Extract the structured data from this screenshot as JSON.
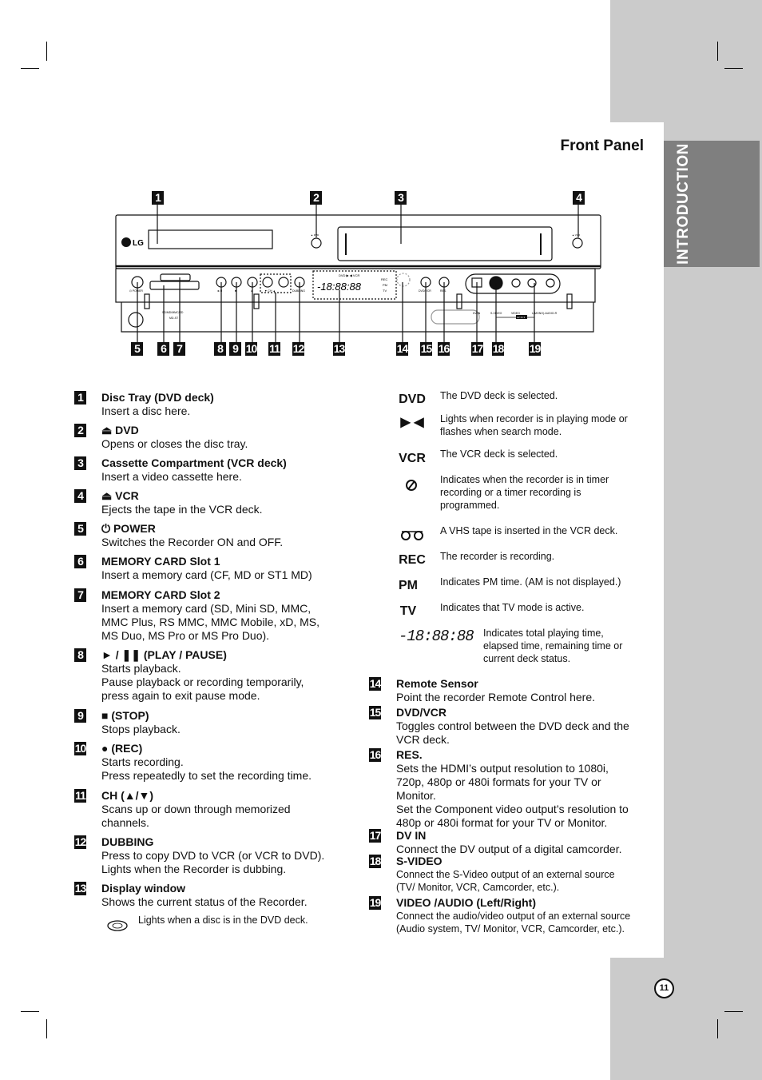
{
  "page": {
    "section_tab": "INTRODUCTION",
    "title": "Front Panel",
    "page_number": "11",
    "colors": {
      "sidebar_gray": "#cbcbcb",
      "tab_gray": "#7f7f7f",
      "badge": "#111111"
    }
  },
  "diagram": {
    "brand": "LG",
    "panel_labels": {
      "eject_dvd": "▲ DVD",
      "eject_vcr": "▲ VCR",
      "power": "⏻ POWER",
      "play_pause": "►/II",
      "stop": "■",
      "rec": "●",
      "ch": "▼  CH  ▲",
      "dubbing": "DUBBING",
      "dvd_vcr": "DVD/VCR",
      "res": "RES.",
      "card_label1": "SD/MD/MMC/SD",
      "card_label2": "MD-ST",
      "dv_in": "DV IN",
      "s_video": "S-VIDEO",
      "video": "VIDEO",
      "audio": "L(MONO)-AUDIO-R",
      "av_in": "AV IN 3"
    },
    "display": {
      "top_row": "DVD ▶ ◀ VCR",
      "digits": "-18:88:88",
      "rec": "REC",
      "pm": "PM",
      "tv": "TV"
    },
    "callouts_top": [
      "1",
      "2",
      "3",
      "4"
    ],
    "callouts_bottom": [
      "5",
      "6",
      "7",
      "8",
      "9",
      "10",
      "11",
      "12",
      "13",
      "14",
      "15",
      "16",
      "17",
      "18",
      "19"
    ]
  },
  "items_left": [
    {
      "num": "1",
      "title": "Disc Tray (DVD deck)",
      "lines": [
        "Insert a disc here."
      ]
    },
    {
      "num": "2",
      "title": "⏏ DVD",
      "lines": [
        "Opens or closes the disc tray."
      ]
    },
    {
      "num": "3",
      "title": "Cassette Compartment (VCR deck)",
      "lines": [
        "Insert a video cassette here."
      ]
    },
    {
      "num": "4",
      "title": "⏏ VCR",
      "lines": [
        "Ejects the tape in the VCR deck."
      ]
    },
    {
      "num": "5",
      "title": "⏻ POWER",
      "lines": [
        "Switches the Recorder ON and OFF."
      ]
    },
    {
      "num": "6",
      "title": "MEMORY CARD Slot 1",
      "lines": [
        "Insert a memory card (CF, MD or ST1 MD)"
      ]
    },
    {
      "num": "7",
      "title": "MEMORY CARD Slot 2",
      "lines": [
        "Insert a memory card (SD, Mini SD, MMC,",
        "MMC Plus, RS MMC, MMC Mobile, xD, MS,",
        "MS Duo, MS Pro or MS Pro Duo)."
      ]
    },
    {
      "num": "8",
      "title": "► / ❚❚ (PLAY / PAUSE)",
      "lines": [
        "Starts playback.",
        "Pause playback or recording temporarily,",
        "press again to exit pause mode."
      ]
    },
    {
      "num": "9",
      "title": "■ (STOP)",
      "lines": [
        "Stops playback."
      ]
    },
    {
      "num": "10",
      "title": "● (REC)",
      "lines": [
        "Starts recording.",
        "Press repeatedly to set the recording time."
      ]
    },
    {
      "num": "11",
      "title": "CH (▲/▼)",
      "lines": [
        "Scans up or down through memorized",
        "channels."
      ]
    },
    {
      "num": "12",
      "title": "DUBBING",
      "lines": [
        "Press to copy DVD to VCR (or VCR to DVD).",
        "Lights when the Recorder is dubbing."
      ]
    },
    {
      "num": "13",
      "title": "Display window",
      "lines": [
        "Shows the current status of the Recorder."
      ]
    }
  ],
  "display_symbols": [
    {
      "icon": "disc-icon",
      "symbol": "",
      "desc": "Lights when a disc is in the DVD deck."
    },
    {
      "icon": "dvd-text",
      "symbol": "DVD",
      "desc": "The DVD deck is selected."
    },
    {
      "icon": "play-search-icon",
      "symbol": "▶ ◀",
      "desc": "Lights when recorder is in playing mode or flashes when search mode."
    },
    {
      "icon": "vcr-text",
      "symbol": "VCR",
      "desc": "The VCR deck is selected."
    },
    {
      "icon": "timer-icon",
      "symbol": "Ø",
      "desc": "Indicates when the recorder is in timer recording or a timer recording is programmed."
    },
    {
      "icon": "tape-icon",
      "symbol": "ơo",
      "desc": "A VHS tape is inserted in the VCR deck."
    },
    {
      "icon": "rec-text",
      "symbol": "REC",
      "desc": "The recorder is recording."
    },
    {
      "icon": "pm-text",
      "symbol": "PM",
      "desc": "Indicates PM time. (AM is not displayed.)"
    },
    {
      "icon": "tv-text",
      "symbol": "TV",
      "desc": "Indicates that TV mode is active."
    },
    {
      "icon": "digits-icon",
      "symbol": "-18:88:88",
      "desc": "Indicates total playing time, elapsed time, remaining time or current deck status."
    }
  ],
  "items_right": [
    {
      "num": "14",
      "title": "Remote Sensor",
      "lines": [
        "Point the recorder Remote Control here."
      ]
    },
    {
      "num": "15",
      "title": "DVD/VCR",
      "lines": [
        "Toggles control between the DVD deck and the",
        "VCR deck."
      ]
    },
    {
      "num": "16",
      "title": "RES.",
      "lines": [
        "Sets the HDMI’s output resolution to 1080i,",
        "720p, 480p or 480i formats for your TV or",
        "Monitor.",
        "Set the Component video output’s resolution to",
        "480p or 480i format for your TV or Monitor."
      ]
    },
    {
      "num": "17",
      "title": "DV IN",
      "lines": [
        "Connect the DV output of a digital camcorder."
      ]
    },
    {
      "num": "18",
      "title": "S-VIDEO",
      "lines": [
        "Connect the S-Video output of an external source",
        "(TV/ Monitor, VCR, Camcorder, etc.)."
      ]
    },
    {
      "num": "19",
      "title": "VIDEO /AUDIO (Left/Right)",
      "lines": [
        "Connect the audio/video output of an external source",
        "(Audio system, TV/ Monitor, VCR, Camcorder, etc.)."
      ]
    }
  ]
}
